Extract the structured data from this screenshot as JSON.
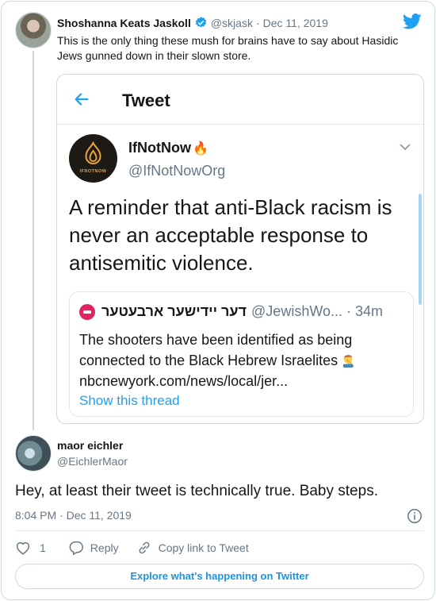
{
  "tweet": {
    "author_name": "Shoshanna Keats Jaskoll",
    "handle": "@skjask",
    "separator": "·",
    "date": "Dec 11, 2019",
    "text": "This is the only thing these mush for brains have to say about Hasidic Jews gunned down in their slown store."
  },
  "embedded": {
    "header_title": "Tweet",
    "account_name": "IfNotNow",
    "name_emoji": "🔥",
    "logo_text": "IFNOTNOW",
    "account_handle": "@IfNotNowOrg",
    "text": "A reminder that anti-Black racism is never an acceptable response to antisemitic violence.",
    "quote": {
      "name": "דער יידישער ארבעטער",
      "handle_time": "@JewishWo... · 34m",
      "text": "The shooters have been identified as being connected to the Black Hebrew Israelites",
      "link": "nbcnewyork.com/news/local/jer...",
      "show_thread": "Show this thread"
    }
  },
  "reply": {
    "author_name": "maor eichler",
    "handle": "@EichlerMaor",
    "text": "Hey, at least their tweet is technically true. Baby steps.",
    "timestamp": "8:04 PM · Dec 11, 2019",
    "likes": "1",
    "reply_label": "Reply",
    "copy_link_label": "Copy link to Tweet"
  },
  "explore_label": "Explore what's happening on Twitter",
  "colors": {
    "twitter_blue": "#1da1f2",
    "text_primary": "#14171a",
    "text_secondary": "#657786",
    "border": "#cfd9de"
  },
  "icons": [
    "verified-badge-icon",
    "twitter-bird-icon",
    "back-arrow-icon",
    "chevron-down-icon",
    "info-icon",
    "heart-icon",
    "reply-icon",
    "link-icon"
  ]
}
